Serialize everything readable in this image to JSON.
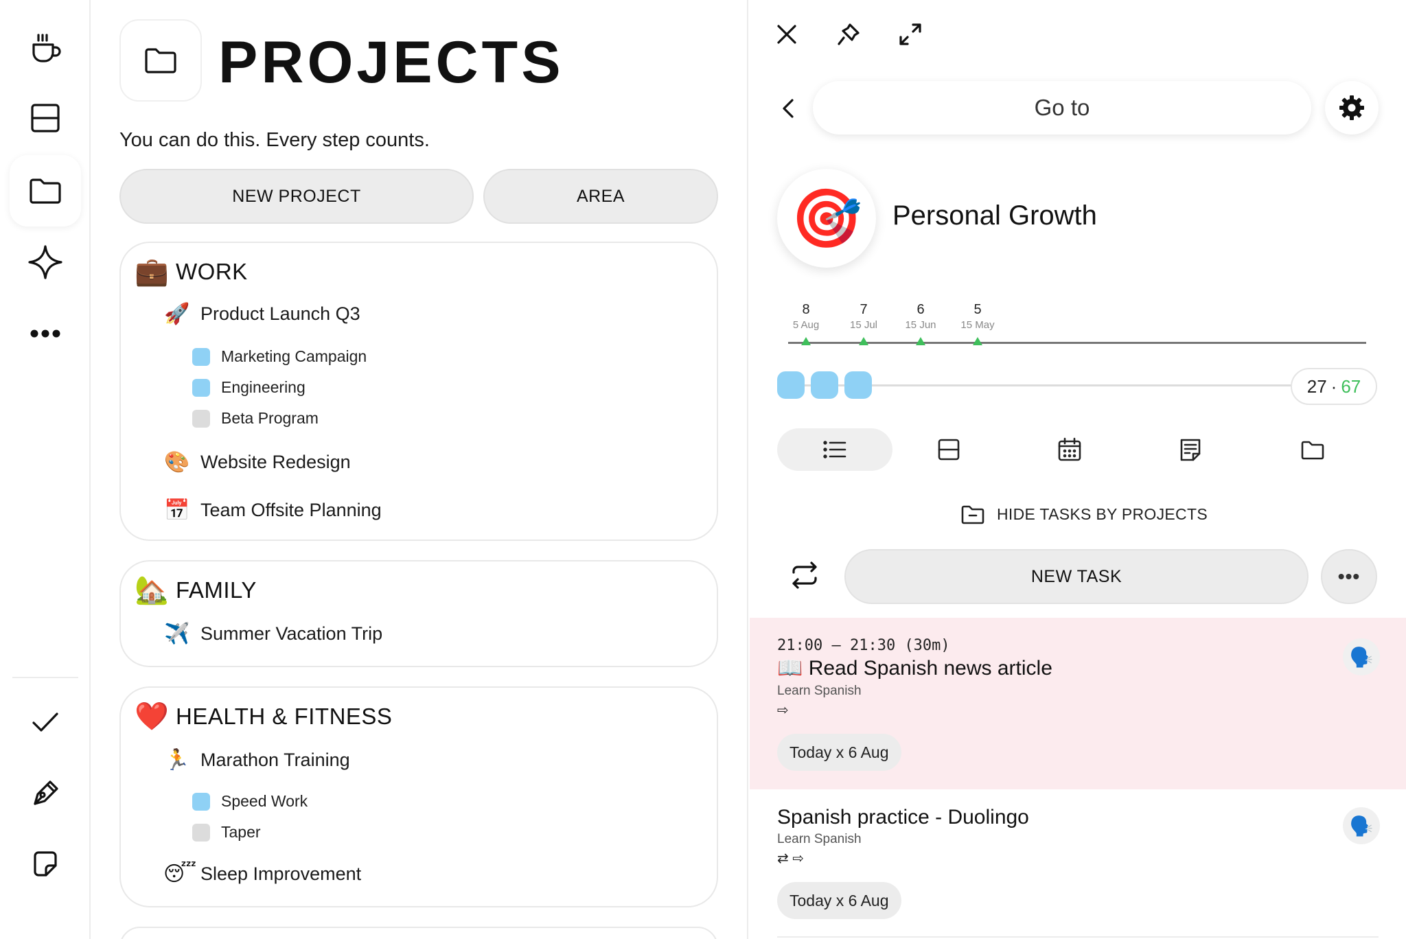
{
  "sidebar": {
    "items": [
      {
        "icon": "coffee-cup-icon"
      },
      {
        "icon": "layout-icon"
      },
      {
        "icon": "folder-icon",
        "active": true
      },
      {
        "icon": "sparkle-icon"
      },
      {
        "icon": "more-dots-icon"
      }
    ],
    "bottom_items": [
      {
        "icon": "checkmark-icon"
      },
      {
        "icon": "pen-icon"
      },
      {
        "icon": "sticky-note-icon"
      }
    ]
  },
  "projects": {
    "title": "PROJECTS",
    "motto": "You can do this. Every step counts.",
    "new_project_label": "NEW PROJECT",
    "area_label": "AREA",
    "areas": [
      {
        "emoji": "💼",
        "name": "WORK",
        "projects": [
          {
            "emoji": "🚀",
            "name": "Product Launch Q3",
            "subprojects": [
              {
                "name": "Marketing Campaign",
                "color": "#8fd1f5"
              },
              {
                "name": "Engineering",
                "color": "#8fd1f5"
              },
              {
                "name": "Beta Program",
                "color": "#dcdcdc"
              }
            ]
          },
          {
            "emoji": "🎨",
            "name": "Website Redesign"
          },
          {
            "emoji": "📅",
            "name": "Team Offsite Planning"
          }
        ]
      },
      {
        "emoji": "🏡",
        "name": "FAMILY",
        "projects": [
          {
            "emoji": "✈️",
            "name": "Summer Vacation Trip"
          }
        ]
      },
      {
        "emoji": "❤️",
        "name": "HEALTH & FITNESS",
        "projects": [
          {
            "emoji": "🏃",
            "name": "Marathon Training",
            "subprojects": [
              {
                "name": "Speed Work",
                "color": "#8fd1f5"
              },
              {
                "name": "Taper",
                "color": "#dcdcdc"
              }
            ]
          },
          {
            "emoji": "😴",
            "name": "Sleep Improvement"
          }
        ]
      }
    ]
  },
  "detail": {
    "toolbar_icons": [
      "close-icon",
      "pin-icon",
      "expand-icon"
    ],
    "goto_label": "Go to",
    "goal": {
      "emoji": "🎯",
      "title": "Personal Growth"
    },
    "timeline": [
      {
        "count": "8",
        "date": "5 Aug"
      },
      {
        "count": "7",
        "date": "15 Jul"
      },
      {
        "count": "6",
        "date": "15 Jun"
      },
      {
        "count": "5",
        "date": "15 May"
      }
    ],
    "progress": {
      "done": "27",
      "separator": "·",
      "total": "67",
      "blocks_filled": 3
    },
    "view_tabs": [
      "list-view-icon",
      "board-view-icon",
      "calendar-view-icon",
      "notes-view-icon",
      "folder-view-icon"
    ],
    "hide_tasks_label": "HIDE TASKS BY PROJECTS",
    "new_task_label": "NEW TASK",
    "more_label": "•••",
    "tasks": [
      {
        "time": "21:00 — 21:30 (30m)",
        "title": "📖 Read Spanish news article",
        "project": "Learn Spanish",
        "flags": "⇨",
        "date": "Today x 6 Aug",
        "icon": "🗣️",
        "highlight": true
      },
      {
        "title": "Spanish practice - Duolingo",
        "project": "Learn Spanish",
        "flags": "⇄ ⇨",
        "date": "Today x 6 Aug",
        "icon": "🗣️",
        "highlight": false
      }
    ]
  },
  "colors": {
    "accent_blue": "#8fd1f5",
    "accent_green": "#3fbf5b",
    "highlight_pink": "#fcebee"
  }
}
